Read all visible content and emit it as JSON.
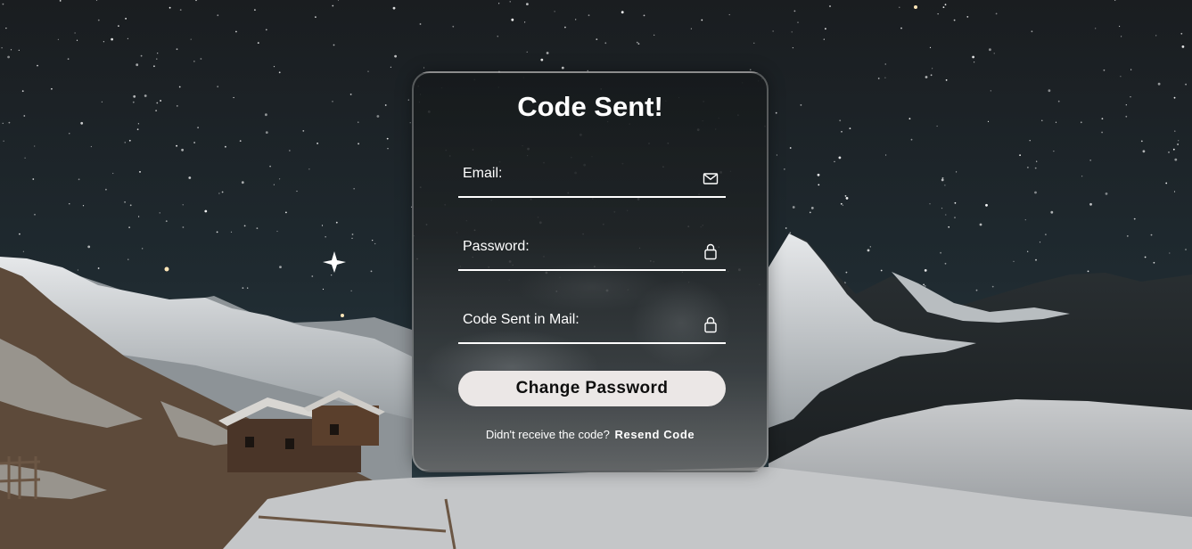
{
  "form": {
    "title": "Code Sent!",
    "email_label": "Email:",
    "password_label": "Password:",
    "code_label": "Code Sent in Mail:",
    "submit_label": "Change Password",
    "resend_prompt": "Didn't receive the code?",
    "resend_link": "Resend Code"
  },
  "icons": {
    "email": "envelope-icon",
    "password": "lock-icon",
    "code": "lock-icon"
  },
  "colors": {
    "text": "#ffffff",
    "button_bg": "#ebe7e6",
    "button_text": "#0e0e0e",
    "sky": "#1e2a30"
  }
}
